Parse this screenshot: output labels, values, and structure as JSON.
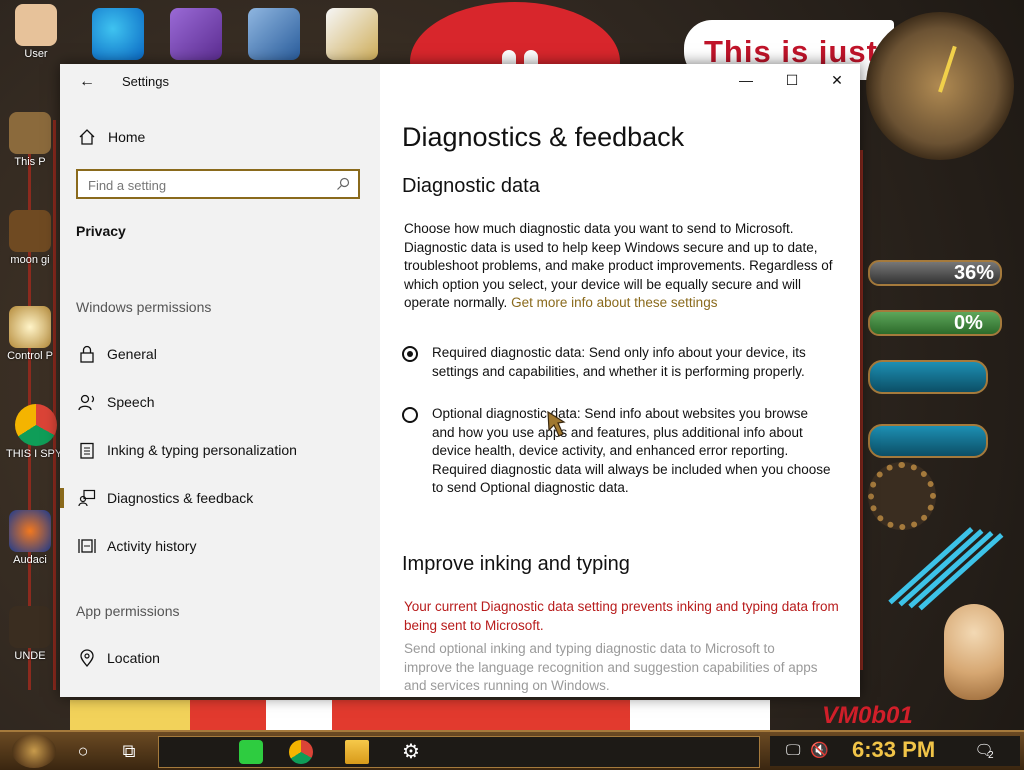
{
  "desktop": {
    "icons": [
      {
        "label": "User"
      },
      {
        "label": "This P"
      },
      {
        "label": "moon gi"
      },
      {
        "label": "Control P"
      },
      {
        "label": "THIS I SPYWA"
      },
      {
        "label": "Audaci"
      },
      {
        "label": "UNDE"
      }
    ],
    "top_icons": [
      {
        "label": "Microsoft Edge"
      },
      {
        "label": "Visual Studio"
      },
      {
        "label": "VirtualBox"
      },
      {
        "label": "HxD"
      }
    ],
    "banner_text": "This is just",
    "vm_text": "VM0b01",
    "gauges": [
      {
        "label": "36%",
        "value": 0.36
      },
      {
        "label": "0%",
        "value": 0.0
      }
    ]
  },
  "window": {
    "title": "Settings",
    "controls": {
      "minimize": "—",
      "maximize": "☐",
      "close": "✕"
    },
    "nav": {
      "home": "Home",
      "search_placeholder": "Find a setting",
      "section": "Privacy",
      "windows_permissions_heading": "Windows permissions",
      "items": [
        {
          "label": "General",
          "icon": "lock-icon"
        },
        {
          "label": "Speech",
          "icon": "speech-icon"
        },
        {
          "label": "Inking & typing personalization",
          "icon": "clipboard-icon"
        },
        {
          "label": "Diagnostics & feedback",
          "icon": "feedback-icon",
          "active": true
        },
        {
          "label": "Activity history",
          "icon": "activity-icon"
        }
      ],
      "app_permissions_heading": "App permissions",
      "app_items": [
        {
          "label": "Location",
          "icon": "location-icon"
        }
      ]
    },
    "content": {
      "page_title": "Diagnostics & feedback",
      "diagnostic_heading": "Diagnostic data",
      "diagnostic_desc": "Choose how much diagnostic data you want to send to Microsoft. Diagnostic data is used to help keep Windows secure and up to date, troubleshoot problems, and make product improvements. Regardless of which option you select, your device will be equally secure and will operate normally.",
      "diagnostic_link": "Get more info about these settings",
      "options": [
        {
          "label": "Required diagnostic data: Send only info about your device, its settings and capabilities, and whether it is performing properly.",
          "checked": true
        },
        {
          "label": "Optional diagnostic data: Send info about websites you browse and how you use apps and features, plus additional info about device health, device activity, and enhanced error reporting. Required diagnostic data will always be included when you choose to send Optional diagnostic data.",
          "checked": false
        }
      ],
      "inking_heading": "Improve inking and typing",
      "inking_warning": "Your current Diagnostic data setting prevents inking and typing data from being sent to Microsoft.",
      "inking_desc": "Send optional inking and typing diagnostic data to Microsoft to improve the language recognition and suggestion capabilities of apps and services running on Windows."
    }
  },
  "taskbar": {
    "time": "6:33 PM",
    "notification_count": "2"
  },
  "colors": {
    "accent": "#8a6a1c",
    "warning": "#b81c1c",
    "nav_bg": "#f2f2f2"
  }
}
